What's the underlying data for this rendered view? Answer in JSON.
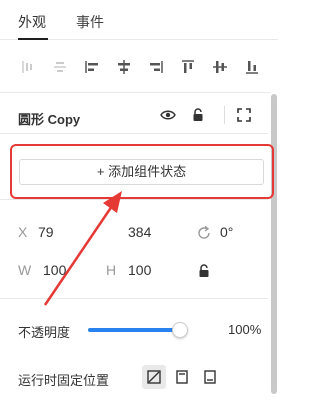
{
  "tabs": {
    "appearance": "外观",
    "events": "事件"
  },
  "align_tools": [
    "align-left-edge-icon",
    "align-horizontal-center-icon",
    "align-left-icon",
    "align-center-icon",
    "align-right-icon",
    "align-top-icon",
    "align-middle-icon",
    "align-bottom-icon"
  ],
  "layer": {
    "name": "圆形 Copy"
  },
  "state": {
    "add_button": "+ 添加组件状态"
  },
  "geometry": {
    "x_label": "X",
    "x_value": "79",
    "y_value": "384",
    "rotation_value": "0°",
    "w_label": "W",
    "w_value": "100",
    "h_label": "H",
    "h_value": "100"
  },
  "opacity": {
    "label": "不透明度",
    "value": "100%",
    "level": 1.0
  },
  "fix_position": {
    "label": "运行时固定位置"
  },
  "colors": {
    "accent": "#2a82f0",
    "highlight": "#e53935"
  }
}
